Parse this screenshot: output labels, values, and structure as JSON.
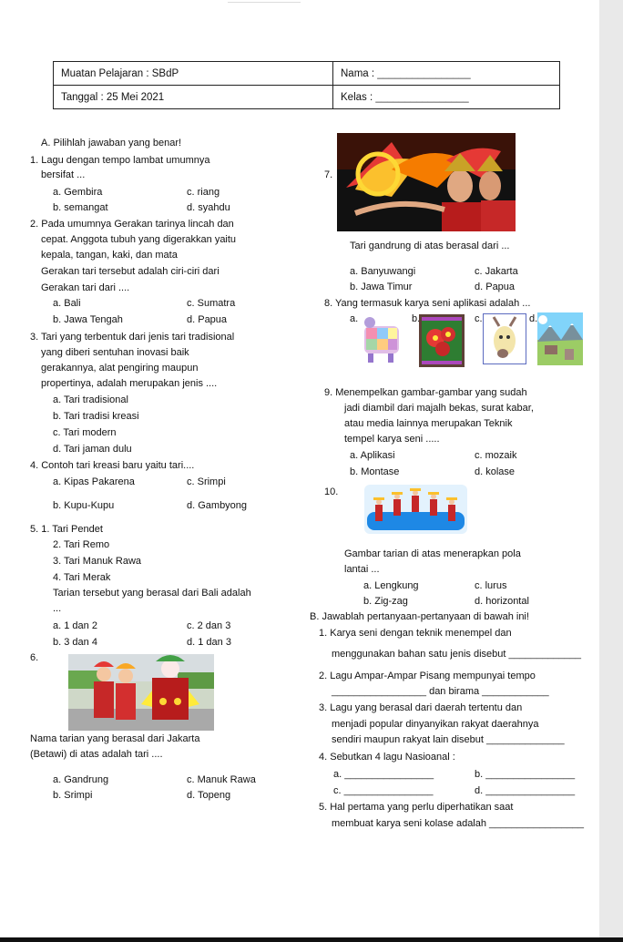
{
  "header": {
    "subject": "Muatan Pelajaran : SBdP",
    "name_label": "Nama : ",
    "date": "Tanggal : 25 Mei 2021",
    "class_label": "Kelas : ",
    "blank": "________________"
  },
  "sectionA": "A.  Pilihlah jawaban yang benar!",
  "q1": {
    "line1": "1.  Lagu dengan tempo lambat umumnya",
    "line2": "bersifat ...",
    "a": "a.  Gembira",
    "c": "c. riang",
    "b": "b.  semangat",
    "d": "d. syahdu"
  },
  "q2": {
    "line1": "2.  Pada umumnya Gerakan tarinya lincah dan",
    "line2": "cepat. Anggota tubuh yang digerakkan yaitu",
    "line3": "kepala, tangan, kaki, dan mata",
    "line4": "Gerakan tari tersebut adalah ciri-ciri dari",
    "line5": "Gerakan tari dari ....",
    "a": "a.  Bali",
    "c": "c. Sumatra",
    "b": "b.  Jawa Tengah",
    "d": "d. Papua"
  },
  "q3": {
    "line1": "3.  Tari yang terbentuk dari jenis tari tradisional",
    "line2": "yang diberi sentuhan inovasi baik",
    "line3": "gerakannya, alat pengiring maupun",
    "line4": "propertinya, adalah merupakan jenis ....",
    "a": "a.  Tari tradisional",
    "b": "b.  Tari tradisi kreasi",
    "c": "c.  Tari modern",
    "d": "d.  Tari jaman dulu"
  },
  "q4": {
    "line1": "4.  Contoh tari kreasi baru yaitu tari....",
    "a": "a.  Kipas Pakarena",
    "c": "c. Srimpi",
    "b": "b.  Kupu-Kupu",
    "d": "d. Gambyong"
  },
  "q5": {
    "l1": "5.  1. Tari Pendet",
    "l2": "2. Tari Remo",
    "l3": "3. Tari Manuk Rawa",
    "l4": "4. Tari Merak",
    "line5": "Tarian tersebut yang berasal dari Bali adalah",
    "line6": "...",
    "a": "a.  1 dan 2",
    "c": "c. 2 dan 3",
    "b": "b.  3 dan 4",
    "d": "d. 1 dan 3"
  },
  "q6": {
    "num": "6.",
    "line1": "Nama tarian yang berasal dari Jakarta",
    "line2": "(Betawi) di atas adalah tari ....",
    "a": "a.  Gandrung",
    "c": "c. Manuk Rawa",
    "b": "b. Srimpi",
    "d": "d. Topeng"
  },
  "q7": {
    "num": "7.",
    "caption": "Tari gandrung di atas berasal dari ...",
    "a": "a.  Banyuwangi",
    "c": "c. Jakarta",
    "b": "b.  Jawa Timur",
    "d": "d. Papua"
  },
  "q8": {
    "line1": "8.  Yang termasuk karya seni aplikasi adalah ...",
    "a": "a.",
    "b": "b.",
    "c": "c.",
    "d": "d."
  },
  "q9": {
    "line1": "9.  Menempelkan gambar-gambar yang sudah",
    "line2": "jadi diambil dari majalh bekas, surat kabar,",
    "line3": "atau media lainnya merupakan Teknik",
    "line4": "tempel karya seni .....",
    "a": "a.  Aplikasi",
    "c": "c. mozaik",
    "b": "b.  Montase",
    "d": "d. kolase"
  },
  "q10": {
    "num": "10.",
    "line1": "Gambar tarian di atas menerapkan pola",
    "line2": "lantai ...",
    "a": "a.  Lengkung",
    "c": "c. lurus",
    "b": "b.  Zig-zag",
    "d": "d. horizontal"
  },
  "sectionB": "B.  Jawablah pertanyaan-pertanyaan di bawah ini!",
  "e1": {
    "line1": "1. Karya seni dengan teknik menempel dan",
    "line2": "menggunakan bahan satu jenis disebut ",
    "blank": "_____________"
  },
  "e2": {
    "line1": "2. Lagu Ampar-Ampar Pisang mempunyai tempo",
    "blank1": "_________________",
    "mid": " dan birama ",
    "blank2": "____________"
  },
  "e3": {
    "line1": "3. Lagu yang berasal dari daerah tertentu dan",
    "line2": "menjadi popular dinyanyikan rakyat daerahnya",
    "line3": "sendiri maupun rakyat lain disebut ",
    "blank": "______________"
  },
  "e4": {
    "line1": "4. Sebutkan 4 lagu Nasioanal :",
    "a": "a. ",
    "b": "b. ",
    "c": "c. ",
    "d": "d. ",
    "blank": "________________"
  },
  "e5": {
    "line1": "5. Hal pertama yang perlu diperhatikan saat",
    "line2": "membuat karya seni kolase adalah ",
    "blank": "_________________"
  }
}
